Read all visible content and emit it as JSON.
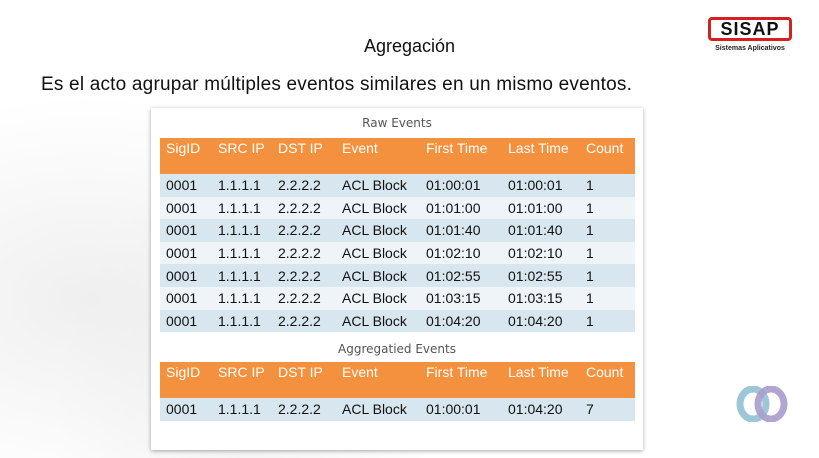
{
  "slide": {
    "title": "Agregación",
    "subtitle": "Es el acto agrupar múltiples eventos similares en un mismo eventos."
  },
  "logo": {
    "name": "SISAP",
    "tagline": "Sistemas Aplicativos"
  },
  "raw_events": {
    "caption": "Raw Events",
    "columns": [
      "SigID",
      "SRC IP",
      "DST IP",
      "Event",
      "First Time",
      "Last Time",
      "Count"
    ],
    "rows": [
      [
        "0001",
        "1.1.1.1",
        "2.2.2.2",
        "ACL Block",
        "01:00:01",
        "01:00:01",
        "1"
      ],
      [
        "0001",
        "1.1.1.1",
        "2.2.2.2",
        "ACL Block",
        "01:01:00",
        "01:01:00",
        "1"
      ],
      [
        "0001",
        "1.1.1.1",
        "2.2.2.2",
        "ACL Block",
        "01:01:40",
        "01:01:40",
        "1"
      ],
      [
        "0001",
        "1.1.1.1",
        "2.2.2.2",
        "ACL Block",
        "01:02:10",
        "01:02:10",
        "1"
      ],
      [
        "0001",
        "1.1.1.1",
        "2.2.2.2",
        "ACL Block",
        "01:02:55",
        "01:02:55",
        "1"
      ],
      [
        "0001",
        "1.1.1.1",
        "2.2.2.2",
        "ACL Block",
        "01:03:15",
        "01:03:15",
        "1"
      ],
      [
        "0001",
        "1.1.1.1",
        "2.2.2.2",
        "ACL Block",
        "01:04:20",
        "01:04:20",
        "1"
      ]
    ]
  },
  "aggregated_events": {
    "caption": "Aggregatied Events",
    "columns": [
      "SigID",
      "SRC IP",
      "DST IP",
      "Event",
      "First Time",
      "Last Time",
      "Count"
    ],
    "rows": [
      [
        "0001",
        "1.1.1.1",
        "2.2.2.2",
        "ACL Block",
        "01:00:01",
        "01:04:20",
        "7"
      ]
    ]
  },
  "colors": {
    "header_bg": "#f4913e",
    "row_odd": "#d8e6ef",
    "row_even": "#eef4f8",
    "logo_red": "#d42020"
  },
  "icons": {
    "corner_mark": "interlocked-rings-icon"
  }
}
